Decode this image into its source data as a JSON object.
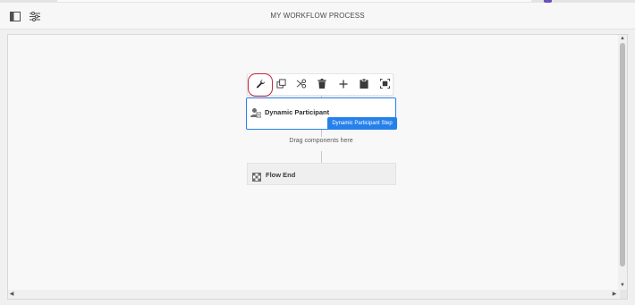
{
  "header": {
    "title": "MY WORKFLOW PROCESS",
    "left_icons": [
      "side-panel-icon",
      "adjust-settings-icon"
    ]
  },
  "toolbar": {
    "buttons": [
      {
        "name": "configure",
        "icon": "wrench-icon",
        "selected": true
      },
      {
        "name": "copy",
        "icon": "copy-icon",
        "selected": false
      },
      {
        "name": "cut",
        "icon": "scissors-icon",
        "selected": false
      },
      {
        "name": "delete",
        "icon": "trash-icon",
        "selected": false
      },
      {
        "name": "insert",
        "icon": "plus-icon",
        "selected": false
      },
      {
        "name": "paste",
        "icon": "clipboard-icon",
        "selected": false
      },
      {
        "name": "select-parent",
        "icon": "select-parent-icon",
        "selected": false
      }
    ]
  },
  "workflow": {
    "step": {
      "label": "Dynamic Participant",
      "badge": "Dynamic Participant Step",
      "icon": "dynamic-participant-icon"
    },
    "placeholder": "Drag components here",
    "end": {
      "label": "Flow End",
      "icon": "flow-end-icon"
    }
  },
  "colors": {
    "accent": "#2680eb",
    "selection_outline": "#c3273b"
  }
}
